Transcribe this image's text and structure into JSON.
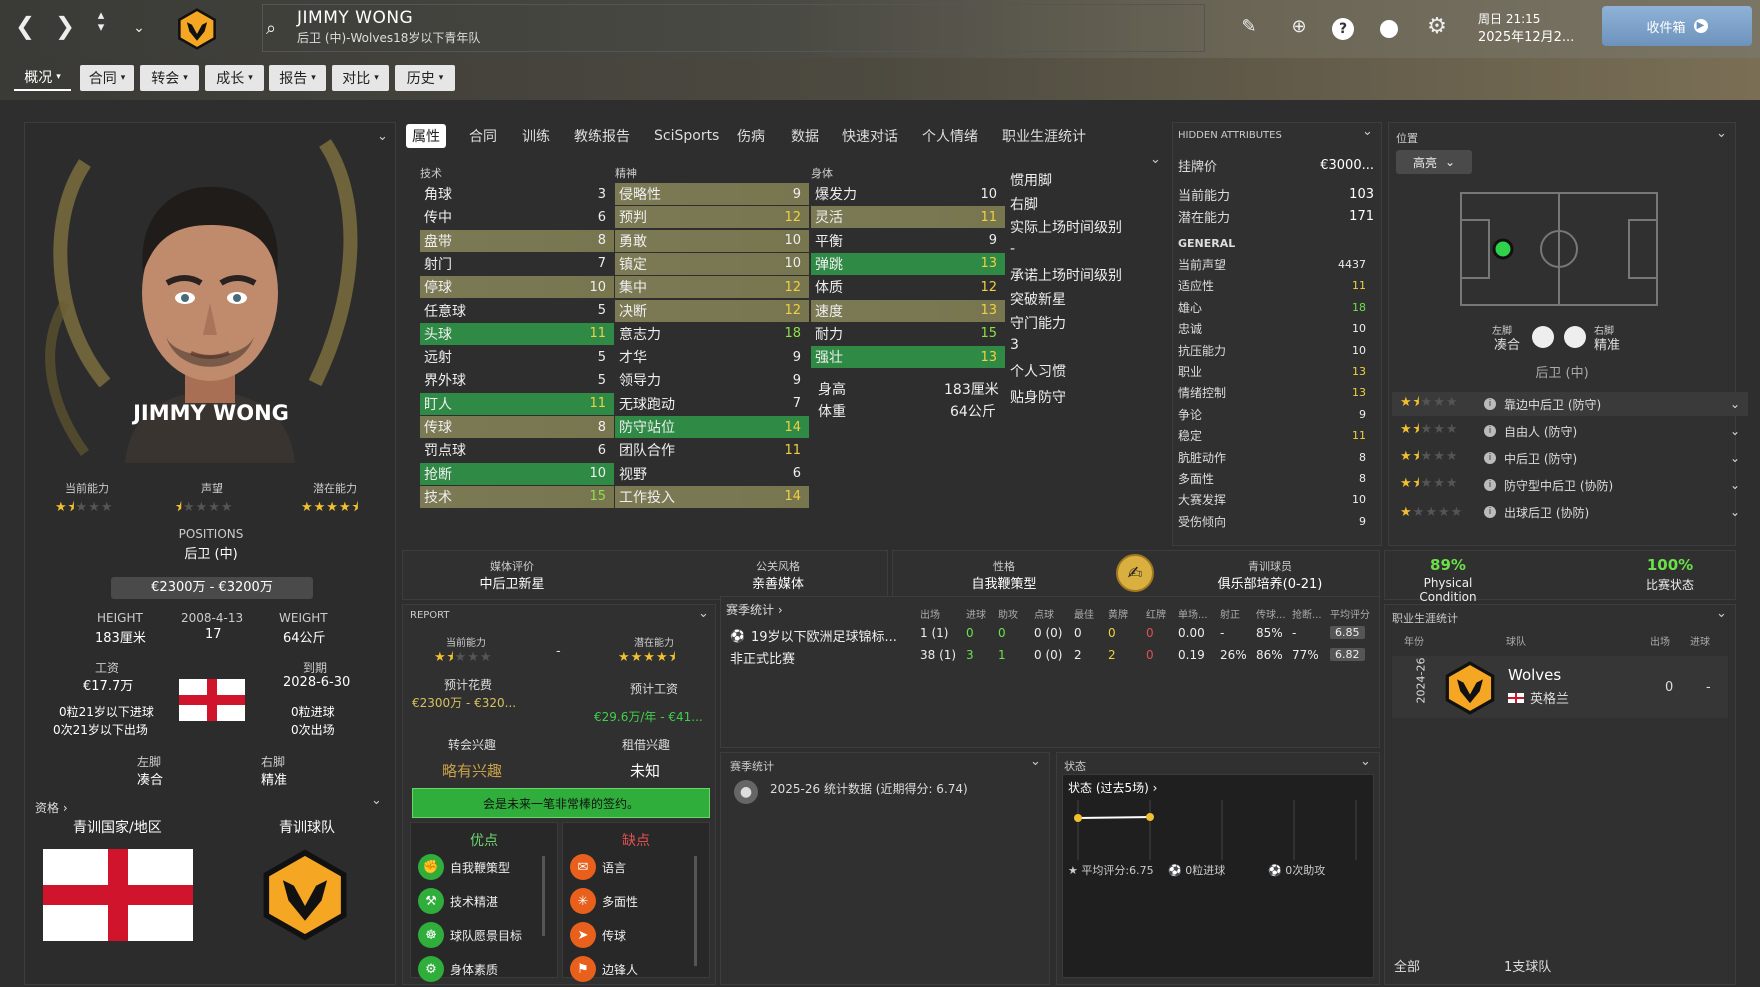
{
  "header": {
    "player_name": "JIMMY WONG",
    "player_sub": "后卫 (中)-Wolves18岁以下青年队",
    "datetime_day": "周日 21:15",
    "datetime_date": "2025年12月2...",
    "inbox_label": "收件箱"
  },
  "menu": [
    {
      "label": "概况",
      "active": true
    },
    {
      "label": "合同"
    },
    {
      "label": "转会"
    },
    {
      "label": "成长"
    },
    {
      "label": "报告"
    },
    {
      "label": "对比"
    },
    {
      "label": "历史"
    }
  ],
  "tabs": [
    "属性",
    "合同",
    "训练",
    "教练报告",
    "SciSports",
    "伤病",
    "数据",
    "快速对话",
    "个人情绪",
    "职业生涯统计"
  ],
  "profile": {
    "name": "JIMMY WONG",
    "ca_label": "当前能力",
    "rep_label": "声望",
    "pa_label": "潜在能力",
    "positions_label": "POSITIONS",
    "positions": "后卫 (中)",
    "value_range": "€2300万 - €3200万",
    "height_label": "HEIGHT",
    "height": "183厘米",
    "dob": "2008-4-13",
    "age": "17",
    "weight_label": "WEIGHT",
    "weight": "64公斤",
    "wage_label": "工资",
    "wage": "€17.7万",
    "expiry_label": "到期",
    "expiry": "2028-6-30",
    "u21_goals": "0粒21岁以下进球",
    "u21_apps": "0次21岁以下出场",
    "goals": "0粒进球",
    "apps": "0次出场",
    "left_foot_label": "左脚",
    "left_foot": "凑合",
    "right_foot_label": "右脚",
    "right_foot": "精准",
    "qual_label": "资格",
    "youth_nation_label": "青训国家/地区",
    "youth_club_label": "青训球队"
  },
  "attrs": {
    "tech_title": "技术",
    "mental_title": "精神",
    "phys_title": "身体",
    "technical": [
      {
        "n": "角球",
        "v": "3"
      },
      {
        "n": "传中",
        "v": "6"
      },
      {
        "n": "盘带",
        "v": "8"
      },
      {
        "n": "射门",
        "v": "7"
      },
      {
        "n": "停球",
        "v": "10"
      },
      {
        "n": "任意球",
        "v": "5"
      },
      {
        "n": "头球",
        "v": "11"
      },
      {
        "n": "远射",
        "v": "5"
      },
      {
        "n": "界外球",
        "v": "5"
      },
      {
        "n": "盯人",
        "v": "11"
      },
      {
        "n": "传球",
        "v": "8"
      },
      {
        "n": "罚点球",
        "v": "6"
      },
      {
        "n": "抢断",
        "v": "10"
      },
      {
        "n": "技术",
        "v": "15"
      }
    ],
    "mental": [
      {
        "n": "侵略性",
        "v": "9"
      },
      {
        "n": "预判",
        "v": "12"
      },
      {
        "n": "勇敢",
        "v": "10"
      },
      {
        "n": "镇定",
        "v": "10"
      },
      {
        "n": "集中",
        "v": "12"
      },
      {
        "n": "决断",
        "v": "12"
      },
      {
        "n": "意志力",
        "v": "18"
      },
      {
        "n": "才华",
        "v": "9"
      },
      {
        "n": "领导力",
        "v": "9"
      },
      {
        "n": "无球跑动",
        "v": "7"
      },
      {
        "n": "防守站位",
        "v": "14"
      },
      {
        "n": "团队合作",
        "v": "11"
      },
      {
        "n": "视野",
        "v": "6"
      },
      {
        "n": "工作投入",
        "v": "14"
      }
    ],
    "physical": [
      {
        "n": "爆发力",
        "v": "10"
      },
      {
        "n": "灵活",
        "v": "11"
      },
      {
        "n": "平衡",
        "v": "9"
      },
      {
        "n": "弹跳",
        "v": "13"
      },
      {
        "n": "体质",
        "v": "12"
      },
      {
        "n": "速度",
        "v": "13"
      },
      {
        "n": "耐力",
        "v": "15"
      },
      {
        "n": "强壮",
        "v": "13"
      }
    ],
    "height_label": "身高",
    "height": "183厘米",
    "weight_label": "体重",
    "weight": "64公斤",
    "side": [
      "惯用脚",
      "右脚",
      "实际上场时间级别",
      "-",
      "承诺上场时间级别",
      "突破新星",
      "守门能力",
      "3",
      "个人习惯",
      "贴身防守"
    ]
  },
  "hidden": {
    "title": "HIDDEN ATTRIBUTES",
    "value_label": "挂牌价",
    "value": "€3000...",
    "ca_label": "当前能力",
    "ca": "103",
    "pa_label": "潜在能力",
    "pa": "171",
    "general_title": "GENERAL",
    "rows": [
      {
        "n": "当前声望",
        "v": "4437",
        "c": "w"
      },
      {
        "n": "适应性",
        "v": "11",
        "c": "y"
      },
      {
        "n": "雄心",
        "v": "18",
        "c": "g"
      },
      {
        "n": "忠诚",
        "v": "10",
        "c": "w"
      },
      {
        "n": "抗压能力",
        "v": "10",
        "c": "w"
      },
      {
        "n": "职业",
        "v": "13",
        "c": "y"
      },
      {
        "n": "情绪控制",
        "v": "13",
        "c": "y"
      },
      {
        "n": "争论",
        "v": "9",
        "c": "w"
      },
      {
        "n": "稳定",
        "v": "11",
        "c": "y"
      },
      {
        "n": "肮脏动作",
        "v": "8",
        "c": "w"
      },
      {
        "n": "多面性",
        "v": "8",
        "c": "w"
      },
      {
        "n": "大赛发挥",
        "v": "10",
        "c": "w"
      },
      {
        "n": "受伤倾向",
        "v": "9",
        "c": "w"
      }
    ]
  },
  "position": {
    "title": "位置",
    "highlight": "高亮",
    "left_foot_label": "左脚",
    "left_foot": "凑合",
    "right_foot_label": "右脚",
    "right_foot": "精准",
    "pos": "后卫 (中)",
    "roles": [
      "靠边中后卫 (防守)",
      "自由人 (防守)",
      "中后卫 (防守)",
      "防守型中后卫 (协防)",
      "出球后卫 (协防)"
    ]
  },
  "info": {
    "media_label": "媒体评价",
    "media": "中后卫新星",
    "pr_label": "公关风格",
    "pr": "亲善媒体",
    "persona_label": "性格",
    "persona": "自我鞭策型",
    "youth_label": "青训球员",
    "youth": "俱乐部培养(0-21)",
    "cond_pct": "89%",
    "cond_label": "Physical Condition",
    "match_pct": "100%",
    "match_label": "比赛状态"
  },
  "report": {
    "title": "REPORT",
    "ca_label": "当前能力",
    "pa_label": "潜在能力",
    "dash": "-",
    "fee_label": "预计花费",
    "fee": "€2300万 - €320...",
    "wage_label": "预计工资",
    "wage": "€29.6万/年 - €41...",
    "transfer_label": "转会兴趣",
    "transfer": "略有兴趣",
    "loan_label": "租借兴趣",
    "loan": "未知",
    "verdict": "会是未来一笔非常棒的签约。",
    "pros_title": "优点",
    "cons_title": "缺点",
    "pros": [
      "自我鞭策型",
      "技术精湛",
      "球队愿景目标",
      "身体素质"
    ],
    "cons": [
      "语言",
      "多面性",
      "传球",
      "边锋人"
    ]
  },
  "season": {
    "title": "赛季统计",
    "cols": [
      "出场",
      "进球",
      "助攻",
      "点球",
      "最佳",
      "黄牌",
      "红牌",
      "单场...",
      "射正",
      "传球...",
      "抢断...",
      "平均评分"
    ],
    "rows": [
      {
        "name": "19岁以下欧洲足球锦标...",
        "vals": [
          "1 (1)",
          "0",
          "0",
          "0 (0)",
          "0",
          "0",
          "0",
          "0.00",
          "-",
          "85%",
          "-",
          "6.85"
        ]
      },
      {
        "name": "非正式比赛",
        "vals": [
          "38 (1)",
          "3",
          "1",
          "0 (0)",
          "2",
          "2",
          "0",
          "0.19",
          "26%",
          "86%",
          "77%",
          "6.82"
        ]
      }
    ]
  },
  "season2": {
    "title": "赛季统计",
    "text": "2025-26 统计数据 (近期得分: 6.74)"
  },
  "form": {
    "title": "状态",
    "sub": "状态 (过去5场)",
    "avg": "平均评分:6.75",
    "goals": "0粒进球",
    "assists": "0次助攻"
  },
  "career": {
    "title": "职业生涯统计",
    "col_year": "年份",
    "col_club": "球队",
    "col_apps": "出场",
    "col_goals": "进球",
    "season": "2024-26",
    "club": "Wolves",
    "country": "英格兰",
    "apps": "0",
    "goals": "-",
    "footer_all": "全部",
    "footer_clubs": "1支球队"
  },
  "colors": {
    "gold": "#f0c030",
    "wolves_orange": "#f5a623",
    "green": "#2fae3c",
    "yellow_val": "#f0d040"
  }
}
